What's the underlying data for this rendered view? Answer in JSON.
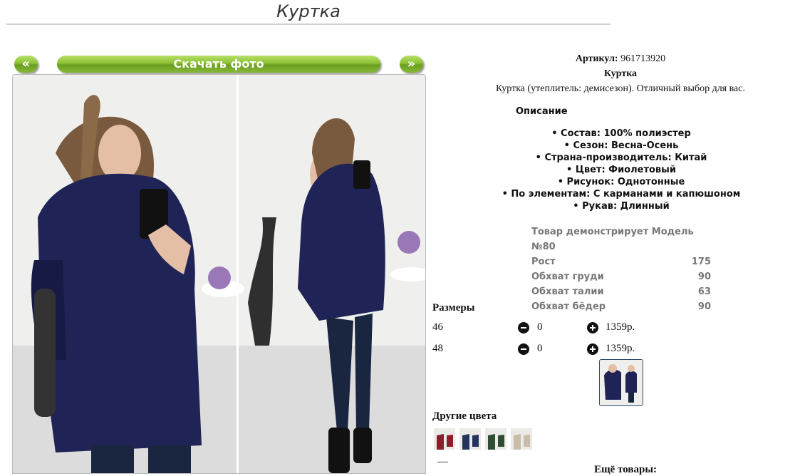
{
  "page": {
    "title": "Куртка"
  },
  "gallery": {
    "prev_label": "«",
    "download_label": "Скачать фото",
    "next_label": "»"
  },
  "product": {
    "article_label": "Артикул:",
    "article_value": "961713920",
    "name": "Куртка",
    "short_description": "Куртка (утеплитель: демисезон). Отличный выбор для вас.",
    "description_heading": "Описание",
    "specs": [
      "• Состав: 100% полиэстер",
      "• Сезон: Весна-Осень",
      "• Страна-производитель: Китай",
      "• Цвет: Фиолетовый",
      "• Рисунок: Однотонные",
      "• По элементам: С карманами и капюшоном",
      "• Рукав: Длинный"
    ],
    "garment_color": "#1f2356"
  },
  "model": {
    "heading": "Товар демонстрирует Модель №80",
    "rows": [
      {
        "label": "Рост",
        "value": "175"
      },
      {
        "label": "Обхват груди",
        "value": "90"
      },
      {
        "label": "Обхват талии",
        "value": "63"
      },
      {
        "label": "Обхват бёдер",
        "value": "90"
      }
    ]
  },
  "sizes": {
    "heading": "Размеры",
    "rows": [
      {
        "size": "46",
        "qty": "0",
        "price": "1359р."
      },
      {
        "size": "48",
        "qty": "0",
        "price": "1359р."
      }
    ]
  },
  "other_colors": {
    "heading": "Другие цвета",
    "swatches": [
      "#8a1f2b",
      "#24345f",
      "#2e4d33",
      "#c9bca8"
    ]
  },
  "footer": {
    "dash": "—",
    "more_label": "Ещё товары:"
  },
  "colors": {
    "button_green": "#8cc034",
    "title_gray": "#333333",
    "muted_gray": "#777777"
  }
}
